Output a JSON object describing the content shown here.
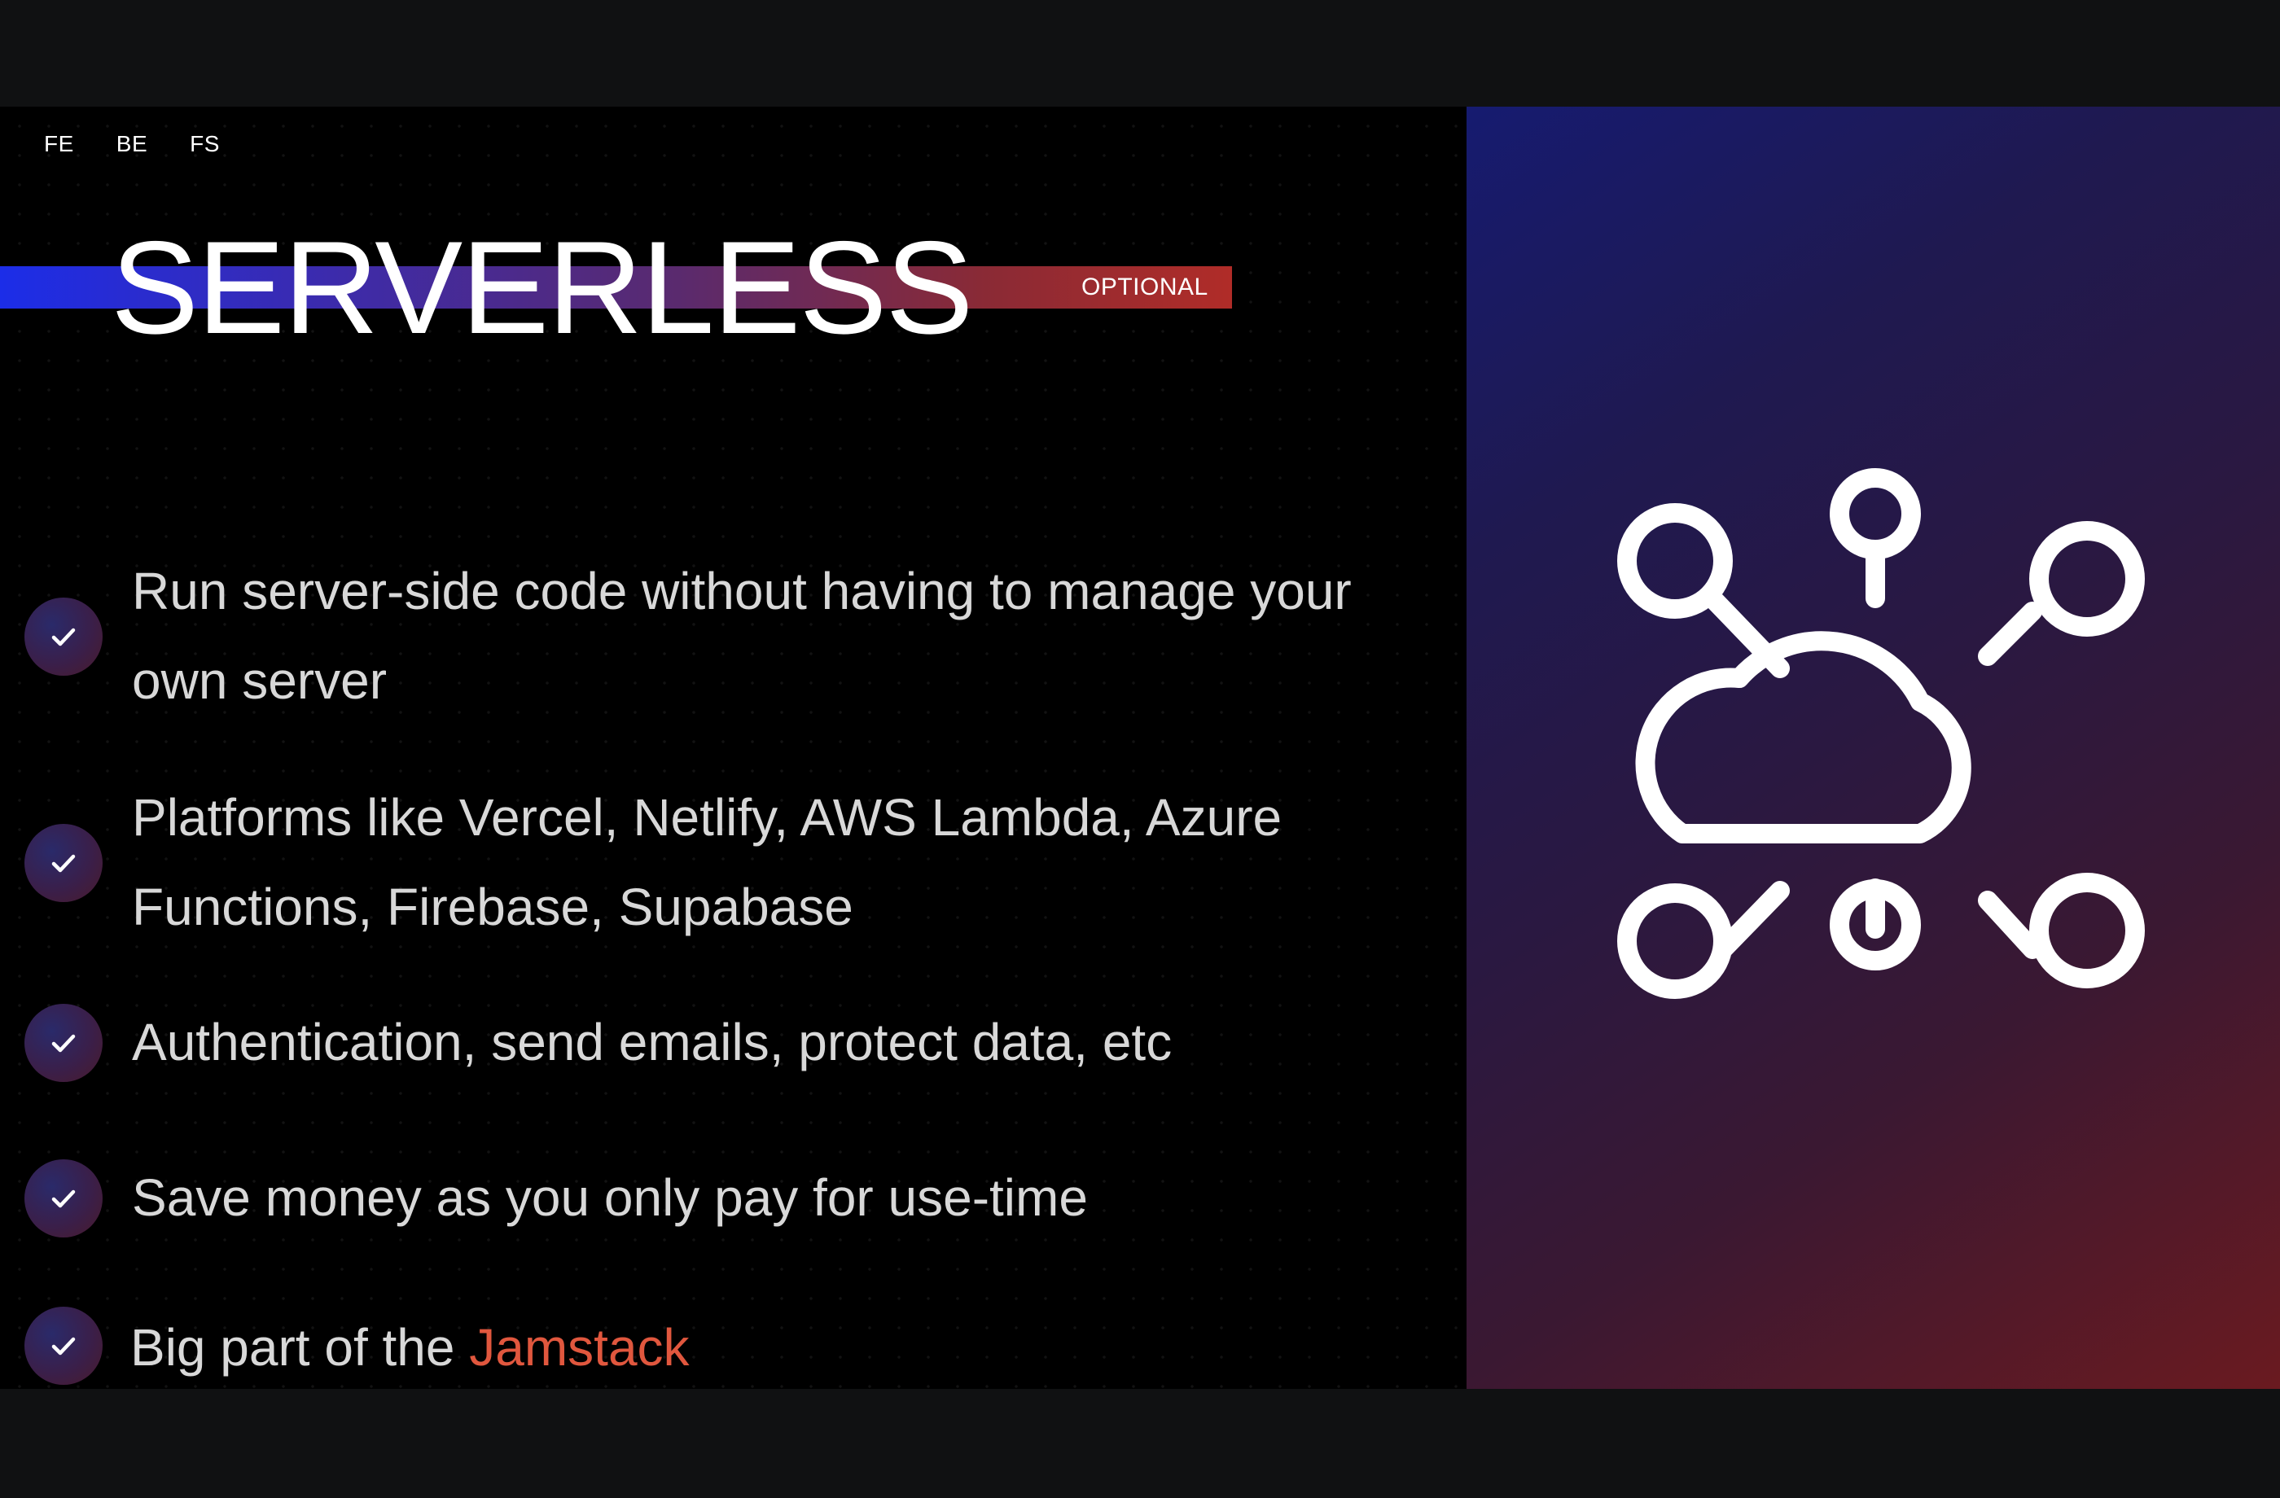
{
  "slide": {
    "tags": [
      "FE",
      "BE",
      "FS"
    ],
    "title": "SERVERLESS",
    "badge": "OPTIONAL",
    "bullets": [
      {
        "text": "Run server-side code without having to manage your own server"
      },
      {
        "text": "Platforms like Vercel, Netlify, AWS Lambda, Azure Functions, Firebase, Supabase"
      },
      {
        "text": "Authentication, send emails, protect data, etc"
      },
      {
        "text": "Save money as you only pay for use-time"
      },
      {
        "text_before": "Big part of the ",
        "highlight": "Jamstack"
      }
    ]
  },
  "icons": {
    "bullet": "check-icon",
    "illustration": "cloud-network-icon",
    "corner": "logo-icon"
  },
  "colors": {
    "background": "#000000",
    "accent": "#e0573e",
    "title_bar_start": "#1c2de8",
    "title_bar_end": "#b02c28",
    "panel_gradient_start": "#161b70",
    "panel_gradient_end": "#6a1a20"
  }
}
